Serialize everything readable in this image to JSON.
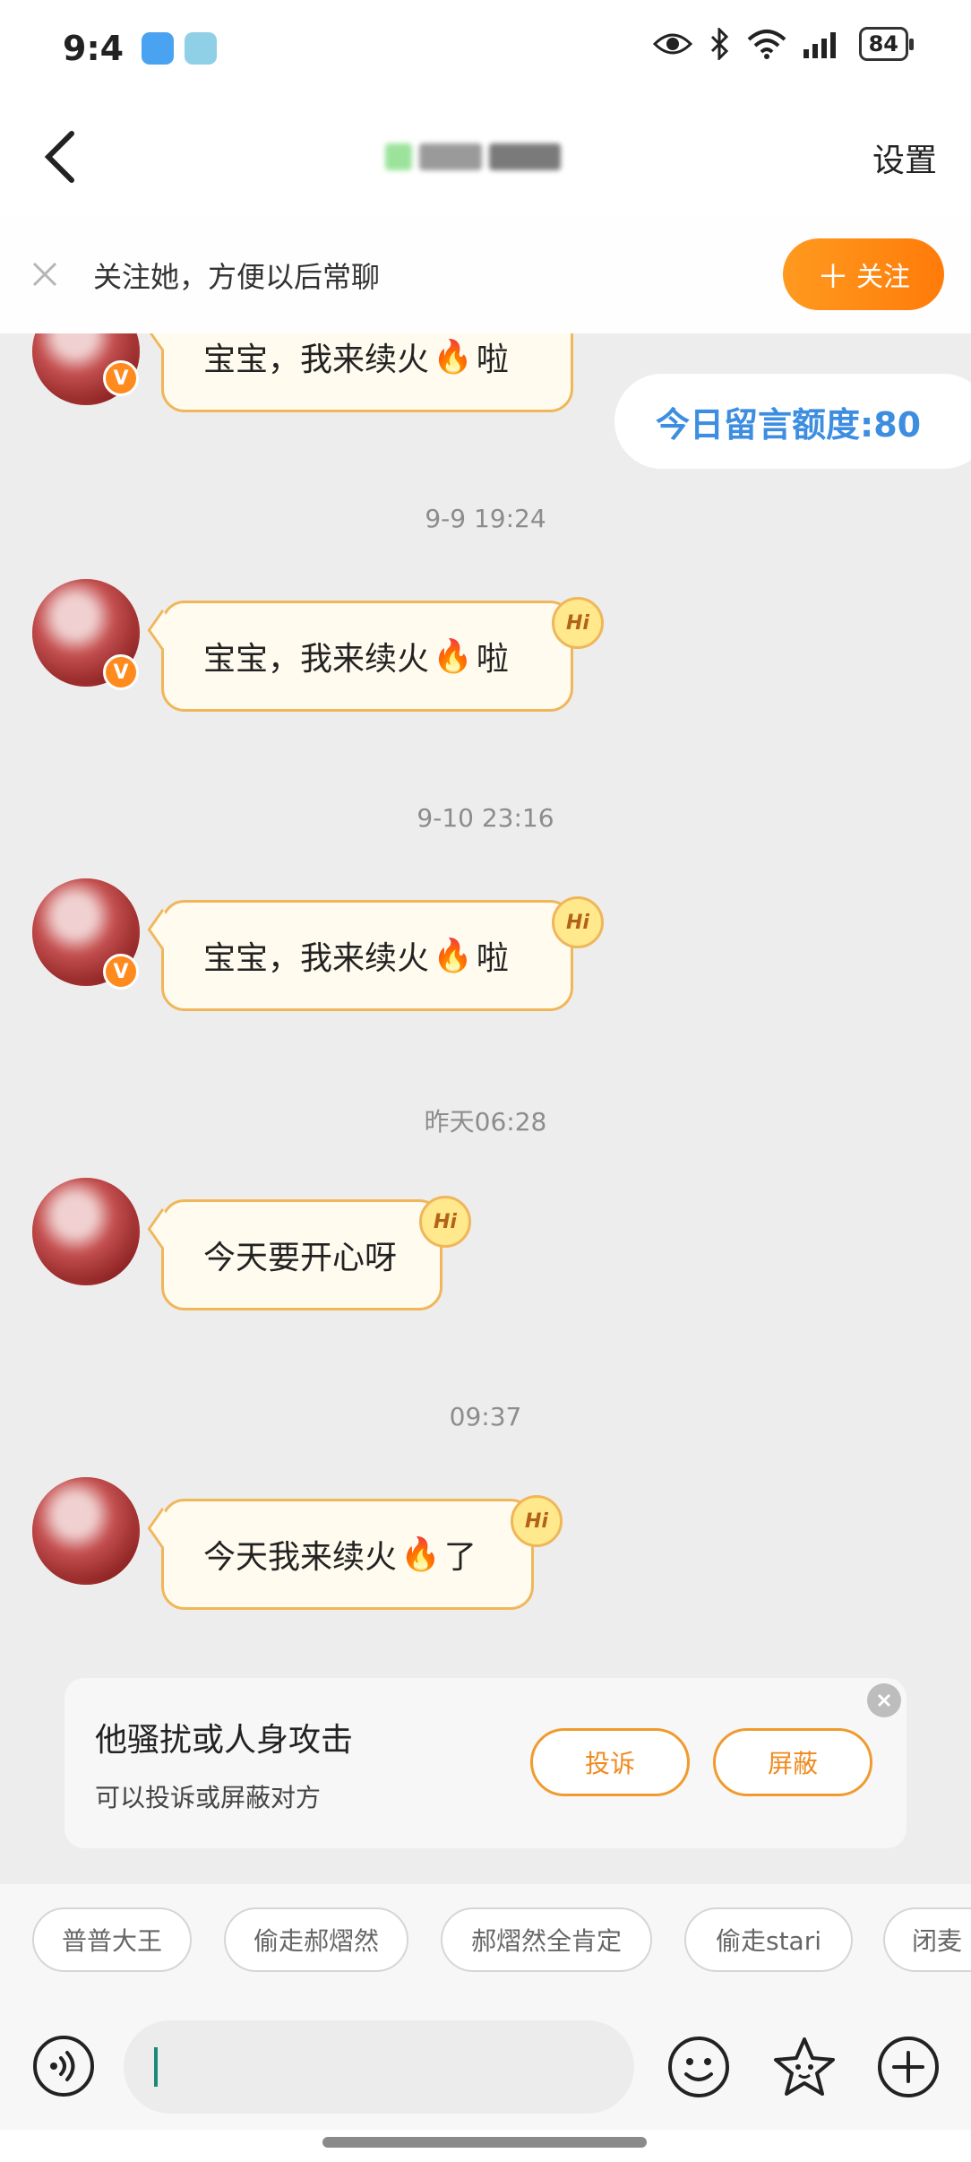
{
  "status_bar": {
    "time": "9:4",
    "battery": "84"
  },
  "nav": {
    "settings_label": "设置"
  },
  "banner": {
    "text": "关注她，方便以后常聊",
    "follow_label": "关注"
  },
  "quota": {
    "label": "今日留言额度:80"
  },
  "messages": [
    {
      "text_before": "宝宝，我来续火",
      "text_after": "啦"
    },
    {
      "timestamp": "9-9 19:24",
      "text_before": "宝宝，我来续火",
      "text_after": "啦"
    },
    {
      "timestamp": "9-10 23:16",
      "text_before": "宝宝，我来续火",
      "text_after": "啦"
    },
    {
      "timestamp": "昨天06:28",
      "text_before": "今天要开心呀",
      "text_after": ""
    },
    {
      "timestamp": "09:37",
      "text_before": "今天我来续火",
      "text_after": "了"
    }
  ],
  "hi_label": "Hi",
  "v_label": "V",
  "report": {
    "title": "他骚扰或人身攻击",
    "subtitle": "可以投诉或屏蔽对方",
    "complain_label": "投诉",
    "block_label": "屏蔽"
  },
  "quick_chips": [
    "普普大王",
    "偷走郝熠然",
    "郝熠然全肯定",
    "偷走stari",
    "闭麦"
  ],
  "colors": {
    "accent_orange": "#ff8a1e",
    "quota_blue": "#3d8ee0",
    "bubble_border": "#f0b65a"
  }
}
